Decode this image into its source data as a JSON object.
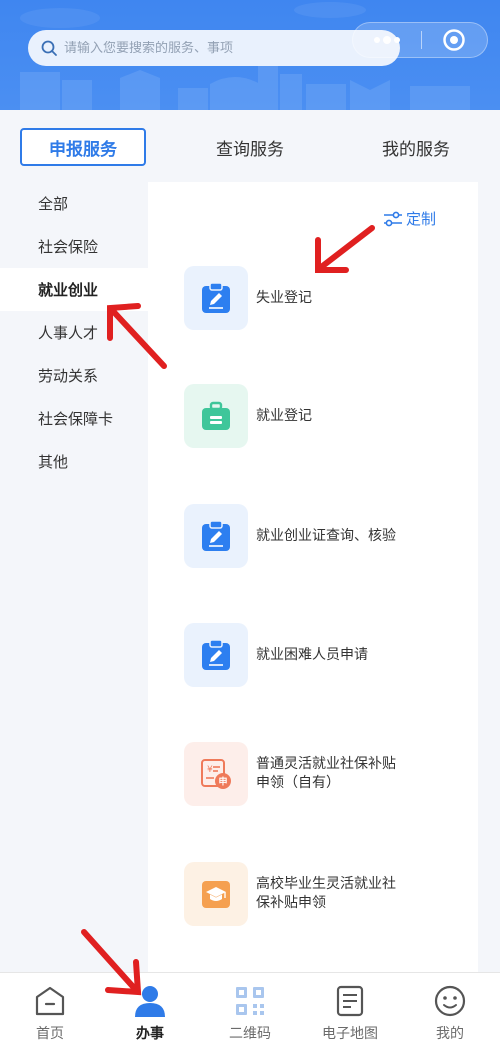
{
  "search": {
    "placeholder": "请输入您要搜索的服务、事项"
  },
  "tabs": [
    {
      "label": "申报服务"
    },
    {
      "label": "查询服务"
    },
    {
      "label": "我的服务"
    }
  ],
  "sidebar": {
    "items": [
      {
        "label": "全部"
      },
      {
        "label": "社会保险"
      },
      {
        "label": "就业创业"
      },
      {
        "label": "人事人才"
      },
      {
        "label": "劳动关系"
      },
      {
        "label": "社会保障卡"
      },
      {
        "label": "其他"
      }
    ]
  },
  "panel": {
    "customize_label": "定制",
    "services": [
      {
        "line1": "失业登记",
        "line2": ""
      },
      {
        "line1": "就业登记",
        "line2": ""
      },
      {
        "line1": "就业创业证查询、核验",
        "line2": ""
      },
      {
        "line1": "就业困难人员申请",
        "line2": ""
      },
      {
        "line1": "普通灵活就业社保补贴",
        "line2": "申领（自有）"
      },
      {
        "line1": "高校毕业生灵活就业社",
        "line2": "保补贴申领"
      }
    ]
  },
  "bottom_nav": [
    {
      "label": "首页"
    },
    {
      "label": "办事"
    },
    {
      "label": "二维码"
    },
    {
      "label": "电子地图"
    },
    {
      "label": "我的"
    }
  ],
  "colors": {
    "header_blue": "#3f86f0",
    "accent": "#2f7be8",
    "arrow_red": "#e02020"
  }
}
